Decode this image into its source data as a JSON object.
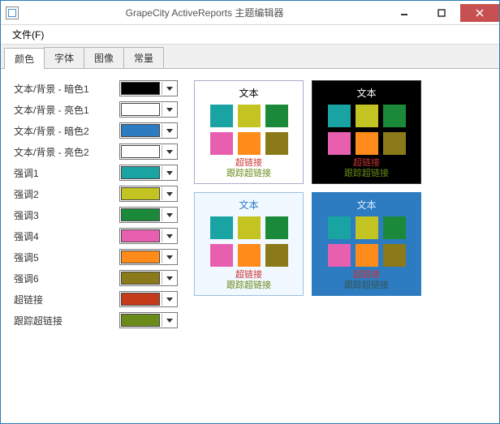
{
  "window": {
    "title": "GrapeCity ActiveReports 主题编辑器"
  },
  "menubar": {
    "file": "文件(F)"
  },
  "tabs": {
    "colors": "颜色",
    "fonts": "字体",
    "images": "图像",
    "constants": "常量"
  },
  "color_rows": [
    {
      "label": "文本/背景 - 暗色1",
      "color": "#000000"
    },
    {
      "label": "文本/背景 - 亮色1",
      "color": "#ffffff"
    },
    {
      "label": "文本/背景 - 暗色2",
      "color": "#2d7bc0"
    },
    {
      "label": "文本/背景 - 亮色2",
      "color": "#ffffff"
    },
    {
      "label": "强调1",
      "color": "#1aa3a3"
    },
    {
      "label": "强调2",
      "color": "#c3c321"
    },
    {
      "label": "强调3",
      "color": "#1a8a3a"
    },
    {
      "label": "强调4",
      "color": "#e85fb0"
    },
    {
      "label": "强调5",
      "color": "#ff8c1a"
    },
    {
      "label": "强调6",
      "color": "#8a7a1a"
    },
    {
      "label": "超链接",
      "color": "#c43b1a"
    },
    {
      "label": "跟踪超链接",
      "color": "#6a8b1a"
    }
  ],
  "accents": [
    "#1aa3a3",
    "#c3c321",
    "#1a8a3a",
    "#e85fb0",
    "#ff8c1a",
    "#8a7a1a"
  ],
  "preview": {
    "text_label": "文本",
    "hyperlink": "超链接",
    "followed": "跟踪超链接"
  }
}
